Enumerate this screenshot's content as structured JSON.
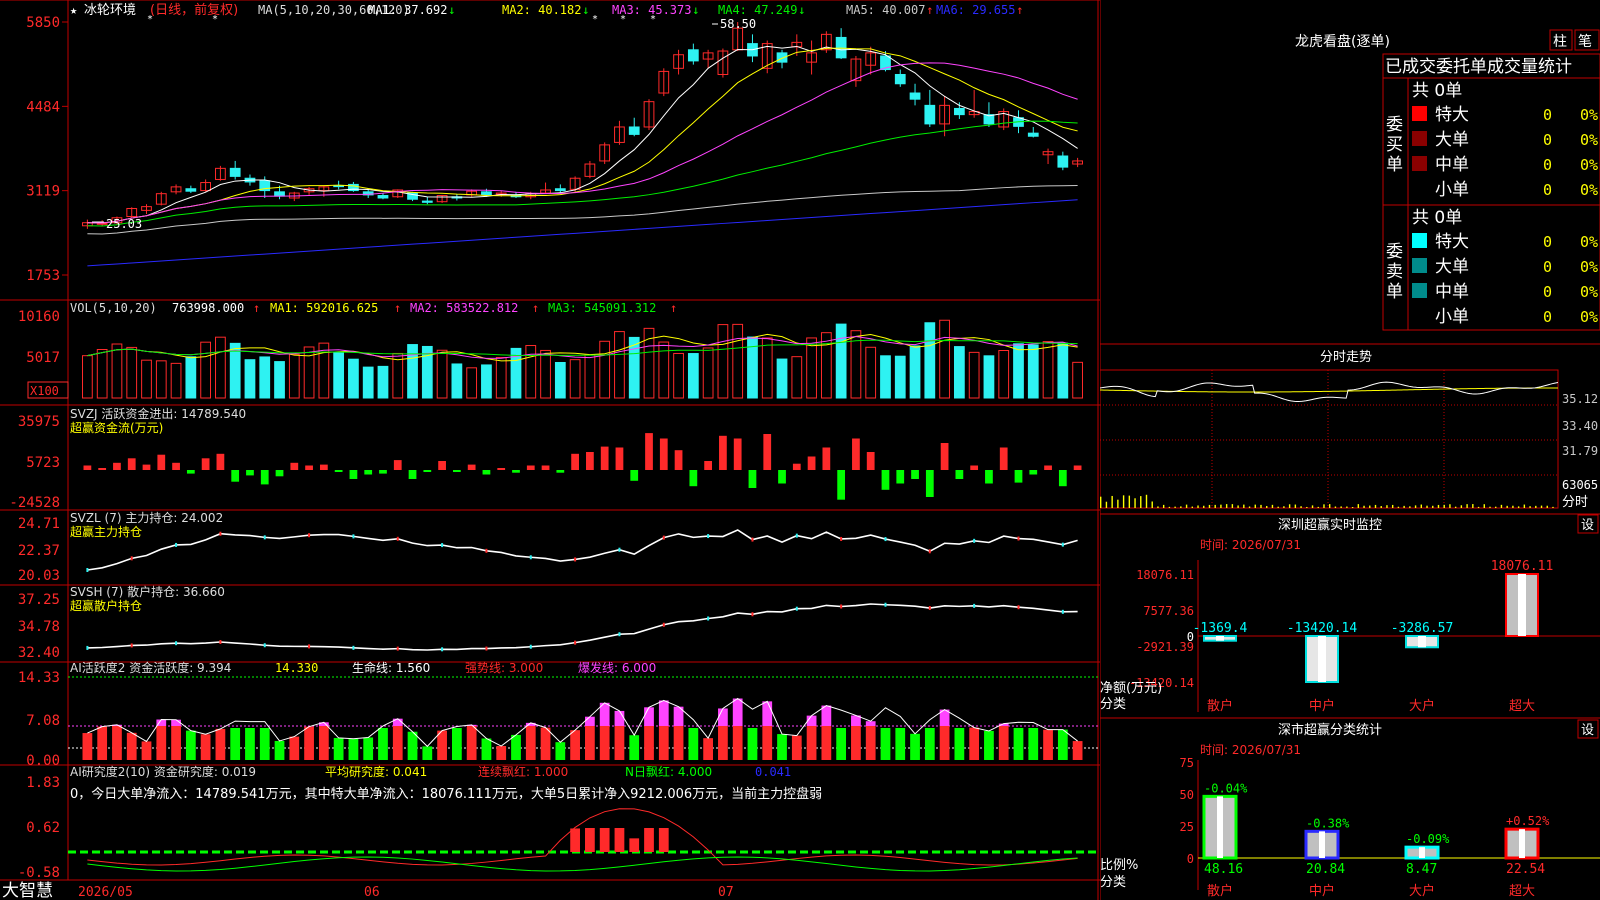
{
  "brand": "大智慧",
  "colors": {
    "up": "#ff2a2a",
    "down": "#2ef2f2",
    "ma1": "#ffffff",
    "ma2": "#ffff00",
    "ma3": "#ff44ff",
    "ma4": "#00ee00",
    "ma5": "#c8c8c8",
    "ma6": "#2a2aff",
    "border": "#c00000",
    "green": "#00ff00",
    "yellow": "#ffff00"
  },
  "main": {
    "stock_name": "冰轮环境",
    "mode": "(日线，前复权)",
    "ma_label": "MA(5,10,20,30,60,120)",
    "ma": [
      {
        "label": "MA1: 37.692",
        "arrow": "↓"
      },
      {
        "label": "MA2: 40.182",
        "arrow": "↓"
      },
      {
        "label": "MA3: 45.373",
        "arrow": "↓"
      },
      {
        "label": "MA4: 47.249",
        "arrow": "↓"
      },
      {
        "label": "MA5: 40.007",
        "arrow": "↑"
      },
      {
        "label": "MA6: 29.655",
        "arrow": "↑"
      }
    ],
    "high_label": "58.50",
    "low_label": "25.03",
    "y_ticks": [
      "5850",
      "4484",
      "3119",
      "1753"
    ]
  },
  "vol": {
    "label": "VOL(5,10,20)",
    "value": "763998.000",
    "ma": [
      "MA1: 592016.625",
      "MA2: 583522.812",
      "MA3: 545091.312"
    ],
    "y_ticks": [
      "10160",
      "5017"
    ],
    "unit": "X100"
  },
  "svzj": {
    "label": "SVZJ  活跃资金进出: 14789.540",
    "sub": "超赢资金流(万元)",
    "y_ticks": [
      "35975",
      "5723",
      "-24528"
    ]
  },
  "svzl": {
    "label": "SVZL (7) 主力持仓: 24.002",
    "sub": "超赢主力持仓",
    "y_ticks": [
      "24.71",
      "22.37",
      "20.03"
    ]
  },
  "svsh": {
    "label": "SVSH (7) 散户持仓: 36.660",
    "sub": "超赢散户持仓",
    "y_ticks": [
      "37.25",
      "34.78",
      "32.40"
    ]
  },
  "ai1": {
    "label": "AI活跃度2 资金活跃度: 9.394",
    "v2": "14.330",
    "v3": "生命线: 1.560",
    "v4": "强势线: 3.000",
    "v5": "爆发线: 6.000",
    "y_ticks": [
      "14.33",
      "7.08",
      "0.00"
    ]
  },
  "ai2": {
    "label": "AI研究度2(10) 资金研究度: 0.019",
    "p2": "平均研究度: 0.041",
    "p3": "连续飘红: 1.000",
    "p4": "N日飘红: 4.000",
    "p5": "0.041",
    "text": "0，今日大单净流入：14789.541万元，其中特大单净流入：18076.111万元，大单5日累计净入9212.006万元，当前主力控盘弱",
    "y_ticks": [
      "1.83",
      "0.62",
      "-0.58"
    ]
  },
  "date_axis": [
    "2026/05",
    "06",
    "07"
  ],
  "lhb": {
    "title": "龙虎看盘(逐单)",
    "btn1": "柱",
    "btn2": "笔",
    "heading": "已成交委托单成交量统计",
    "buy": {
      "side": "委买单",
      "total": "共 0单",
      "rows": [
        [
          "特大",
          "0",
          "0%"
        ],
        [
          "大单",
          "0",
          "0%"
        ],
        [
          "中单",
          "0",
          "0%"
        ],
        [
          "小单",
          "0",
          "0%"
        ]
      ]
    },
    "sell": {
      "side": "委卖单",
      "total": "共 0单",
      "rows": [
        [
          "特大",
          "0",
          "0%"
        ],
        [
          "大单",
          "0",
          "0%"
        ],
        [
          "中单",
          "0",
          "0%"
        ],
        [
          "小单",
          "0",
          "0%"
        ]
      ]
    }
  },
  "intraday": {
    "title": "分时走势",
    "y_labels": [
      "35.12",
      "33.40",
      "31.79",
      "63065"
    ],
    "unit": "分时"
  },
  "monitor": {
    "title": "深圳超赢实时监控",
    "btn": "设",
    "time": "时间: 2026/07/31",
    "y_labels": [
      "18076.11",
      "7577.36",
      "0",
      "-2921.39",
      "-13420.14"
    ],
    "axis_label": "净额(万元)",
    "axis_label2": "分类",
    "categories": [
      "散户",
      "中户",
      "大户",
      "超大"
    ],
    "values": [
      -1369.4,
      -13420.14,
      -3286.57,
      18076.11
    ],
    "value_labels": [
      "-1369.4",
      "-13420.14",
      "-3286.57",
      "18076.11"
    ]
  },
  "classify": {
    "title": "深市超赢分类统计",
    "btn": "设",
    "time": "时间: 2026/07/31",
    "y_labels": [
      "75",
      "50",
      "25",
      "0"
    ],
    "axis_label": "比例%",
    "axis_label2": "分类",
    "categories": [
      "散户",
      "中户",
      "大户",
      "超大"
    ],
    "values": [
      48.16,
      20.84,
      8.47,
      22.54
    ],
    "value_labels": [
      "48.16",
      "20.84",
      "8.47",
      "22.54"
    ],
    "changes": [
      "-0.04%",
      "-0.38%",
      "-0.09%",
      "+0.52%"
    ]
  },
  "chart_data": {
    "type": "candlestick",
    "title": "冰轮环境 (日线，前复权)",
    "x_labels": [
      "2026/05",
      "06",
      "07"
    ],
    "ohlc": [
      [
        25.5,
        26.5,
        25.0,
        26.0
      ],
      [
        25.8,
        26.4,
        25.4,
        25.9
      ],
      [
        26.0,
        27.0,
        25.7,
        26.8
      ],
      [
        27.0,
        28.5,
        26.8,
        28.3
      ],
      [
        28.0,
        29.0,
        27.4,
        28.6
      ],
      [
        29.0,
        31.0,
        28.8,
        30.7
      ],
      [
        31.0,
        32.2,
        30.6,
        31.8
      ],
      [
        31.5,
        32.0,
        30.8,
        31.1
      ],
      [
        31.2,
        33.0,
        31.0,
        32.5
      ],
      [
        33.0,
        35.2,
        32.8,
        34.8
      ],
      [
        34.8,
        36.0,
        33.0,
        33.5
      ],
      [
        33.2,
        33.8,
        32.0,
        32.6
      ],
      [
        32.8,
        33.5,
        30.0,
        31.2
      ],
      [
        31.0,
        32.0,
        29.8,
        30.3
      ],
      [
        30.0,
        31.0,
        29.5,
        30.8
      ],
      [
        31.0,
        31.8,
        30.5,
        31.5
      ],
      [
        31.2,
        32.0,
        30.2,
        31.8
      ],
      [
        32.0,
        32.8,
        31.4,
        31.9
      ],
      [
        32.2,
        32.6,
        31.0,
        31.2
      ],
      [
        31.0,
        31.5,
        30.0,
        30.5
      ],
      [
        30.4,
        30.8,
        29.8,
        30.0
      ],
      [
        30.2,
        31.4,
        30.0,
        31.3
      ],
      [
        30.8,
        31.0,
        29.5,
        29.8
      ],
      [
        29.5,
        30.2,
        29.0,
        29.3
      ],
      [
        29.4,
        30.5,
        29.2,
        30.4
      ],
      [
        30.2,
        30.6,
        29.6,
        30.0
      ],
      [
        30.5,
        31.4,
        30.2,
        31.1
      ],
      [
        31.0,
        31.5,
        30.2,
        30.5
      ],
      [
        30.6,
        31.2,
        30.2,
        30.8
      ],
      [
        30.5,
        31.0,
        30.0,
        30.2
      ],
      [
        30.2,
        31.0,
        29.8,
        30.7
      ],
      [
        30.8,
        32.5,
        30.7,
        31.3
      ],
      [
        31.5,
        32.2,
        30.8,
        31.2
      ],
      [
        31.4,
        33.5,
        31.0,
        33.2
      ],
      [
        33.5,
        36.0,
        33.2,
        35.5
      ],
      [
        36.0,
        39.0,
        35.5,
        38.6
      ],
      [
        39.0,
        42.5,
        38.6,
        41.5
      ],
      [
        41.5,
        43.0,
        40.0,
        40.3
      ],
      [
        41.5,
        46.0,
        41.0,
        45.6
      ],
      [
        47.0,
        51.0,
        46.5,
        50.5
      ],
      [
        51.0,
        54.0,
        50.0,
        53.2
      ],
      [
        54.0,
        55.0,
        51.6,
        52.2
      ],
      [
        52.5,
        54.0,
        51.0,
        53.5
      ],
      [
        50.0,
        54.2,
        49.5,
        53.8
      ],
      [
        54.0,
        58.5,
        53.8,
        57.5
      ],
      [
        55.0,
        56.5,
        52.0,
        53.0
      ],
      [
        51.0,
        55.5,
        50.2,
        55.0
      ],
      [
        53.5,
        54.0,
        51.0,
        52.0
      ],
      [
        54.5,
        56.5,
        53.0,
        55.2
      ],
      [
        52.0,
        55.5,
        50.0,
        53.5
      ],
      [
        54.0,
        57.0,
        53.5,
        56.5
      ],
      [
        56.0,
        57.5,
        52.5,
        52.7
      ],
      [
        49.0,
        53.0,
        48.0,
        52.5
      ],
      [
        51.5,
        54.5,
        50.0,
        53.5
      ],
      [
        53.0,
        53.8,
        50.5,
        50.8
      ],
      [
        50.0,
        50.8,
        48.0,
        48.5
      ],
      [
        47.0,
        48.5,
        45.0,
        46.0
      ],
      [
        45.0,
        47.5,
        41.5,
        42.0
      ],
      [
        42.0,
        46.5,
        40.0,
        45.0
      ],
      [
        44.5,
        45.5,
        42.8,
        43.5
      ],
      [
        43.5,
        47.5,
        43.0,
        44.0
      ],
      [
        43.5,
        45.5,
        41.5,
        42.0
      ],
      [
        41.5,
        44.5,
        41.0,
        44.0
      ],
      [
        43.0,
        44.2,
        40.5,
        41.6
      ],
      [
        40.5,
        41.5,
        39.8,
        40.0
      ],
      [
        37.0,
        38.0,
        35.5,
        37.5
      ],
      [
        36.8,
        37.5,
        34.5,
        35.0
      ],
      [
        35.5,
        36.5,
        35.0,
        36.0
      ]
    ],
    "ma_series": [
      "MA1",
      "MA2",
      "MA3",
      "MA4",
      "MA5",
      "MA6"
    ],
    "y_range": [
      17.53,
      58.5
    ]
  }
}
